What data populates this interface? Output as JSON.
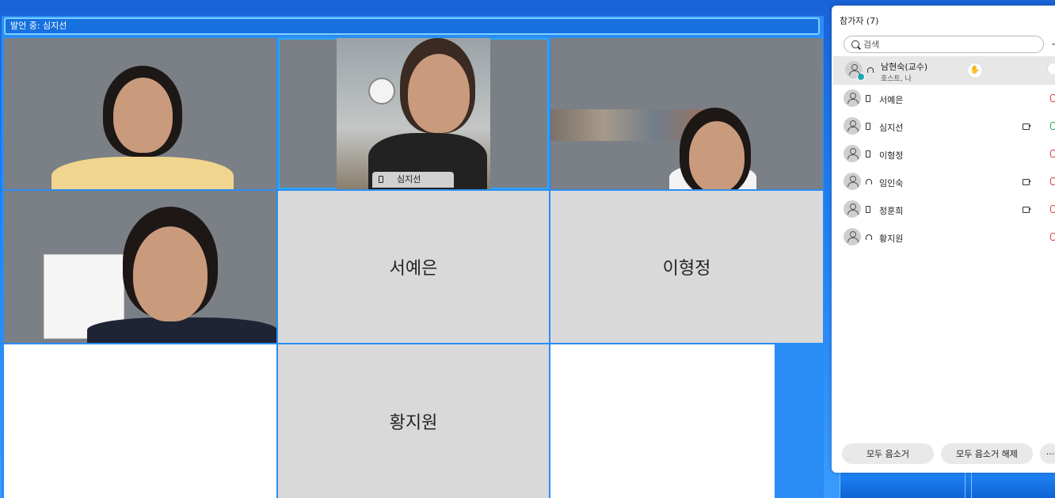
{
  "meeting": {
    "speaking_label": "발언 중: 심지선",
    "tiles": [
      {
        "name": "",
        "type": "video"
      },
      {
        "name": "심지선",
        "type": "video",
        "active": true
      },
      {
        "name": "",
        "type": "video"
      },
      {
        "name": "",
        "type": "video"
      },
      {
        "name": "서예은",
        "type": "avatar"
      },
      {
        "name": "이형정",
        "type": "avatar"
      },
      {
        "name": "",
        "type": "empty"
      },
      {
        "name": "황지원",
        "type": "avatar"
      },
      {
        "name": "",
        "type": "empty"
      }
    ]
  },
  "panel": {
    "title": "참가자 (7)",
    "search_placeholder": "검색",
    "participants": [
      {
        "name": "남현숙(교수)",
        "sub": "호스트, 나",
        "device": "headset",
        "hand_raised": true,
        "camera": false,
        "mic": "muted"
      },
      {
        "name": "서예은",
        "device": "mobile",
        "camera": false,
        "mic": "muted"
      },
      {
        "name": "심지선",
        "device": "mobile",
        "camera": true,
        "mic": "on"
      },
      {
        "name": "이형정",
        "device": "mobile",
        "camera": false,
        "mic": "muted"
      },
      {
        "name": "임인숙",
        "device": "headset",
        "camera": true,
        "mic": "muted"
      },
      {
        "name": "정훈희",
        "device": "mobile",
        "camera": true,
        "mic": "muted"
      },
      {
        "name": "황지원",
        "device": "headset",
        "camera": false,
        "mic": "muted"
      }
    ],
    "mute_all_label": "모두 음소거",
    "unmute_all_label": "모두 음소거 해제",
    "more_label": "···"
  },
  "colors": {
    "desktop_blue": "#1f7ef0",
    "active_outline": "#29a8ff",
    "muted_red": "#d9393b",
    "mic_on_green": "#1fa24a"
  }
}
